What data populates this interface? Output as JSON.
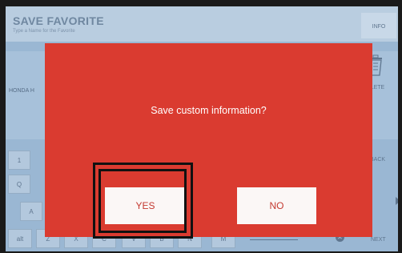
{
  "header": {
    "title": "SAVE FAVORITE",
    "subtitle": "Type a Name for the Favorite",
    "info_label": "INFO"
  },
  "form": {
    "field_label": "HONDA H",
    "delete_label": "DELETE"
  },
  "keyboard": {
    "rows": [
      [
        "1"
      ],
      [
        "Q"
      ],
      [
        "A"
      ],
      [
        "alt",
        "Z",
        "X",
        "C",
        "V",
        "B",
        "N",
        "M"
      ]
    ],
    "back_label": "BACK",
    "next_label": "NEXT"
  },
  "dialog": {
    "message": "Save custom information?",
    "yes_label": "YES",
    "no_label": "NO"
  },
  "colors": {
    "dialog_background": "#da3b30",
    "screen_background": "#9ab7d3",
    "button_background": "#fbf7f6",
    "highlight_frame": "#111111"
  }
}
